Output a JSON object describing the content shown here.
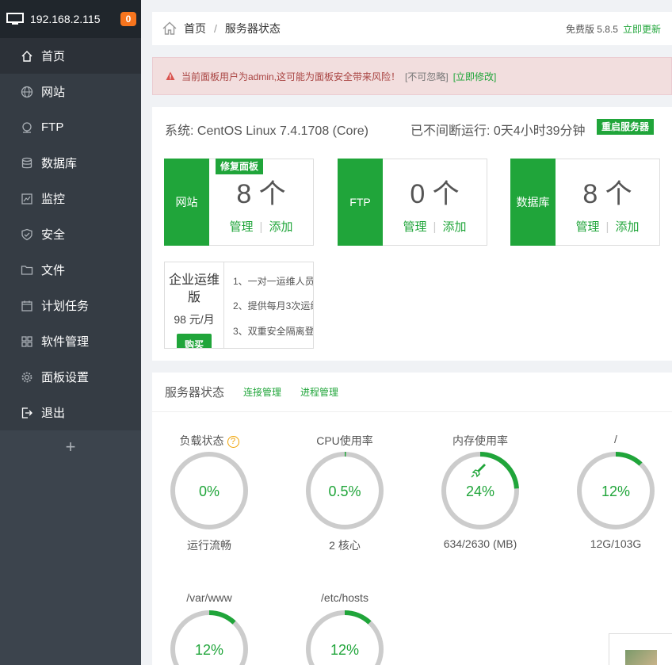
{
  "sidebar": {
    "ip": "192.168.2.115",
    "badge": "0",
    "items": [
      {
        "label": "首页",
        "icon": "home-icon"
      },
      {
        "label": "网站",
        "icon": "globe-icon"
      },
      {
        "label": "FTP",
        "icon": "ftp-icon"
      },
      {
        "label": "数据库",
        "icon": "database-icon"
      },
      {
        "label": "监控",
        "icon": "monitor-icon"
      },
      {
        "label": "安全",
        "icon": "shield-icon"
      },
      {
        "label": "文件",
        "icon": "folder-icon"
      },
      {
        "label": "计划任务",
        "icon": "calendar-icon"
      },
      {
        "label": "软件管理",
        "icon": "grid-icon"
      },
      {
        "label": "面板设置",
        "icon": "gear-icon"
      },
      {
        "label": "退出",
        "icon": "logout-icon"
      }
    ],
    "add": "+"
  },
  "topbar": {
    "crumb_home": "首页",
    "crumb_sep": "/",
    "crumb_current": "服务器状态",
    "version": "免费版 5.8.5",
    "update": "立即更新"
  },
  "alert": {
    "text": "当前面板用户为admin,这可能为面板安全带来风险！",
    "ignore": "[不可忽略]",
    "fix": "[立即修改]"
  },
  "system": {
    "os": "系统: CentOS Linux 7.4.1708 (Core)",
    "uptime": "已不间断运行: 0天4小时39分钟",
    "restart": "重启服务器"
  },
  "cards": [
    {
      "label": "网站",
      "count": "8 个",
      "manage": "管理",
      "sep": "|",
      "add": "添加",
      "tag": "修复面板"
    },
    {
      "label": "FTP",
      "count": "0 个",
      "manage": "管理",
      "sep": "|",
      "add": "添加"
    },
    {
      "label": "数据库",
      "count": "8 个",
      "manage": "管理",
      "sep": "|",
      "add": "添加"
    }
  ],
  "enterprise": {
    "title": "企业运维版",
    "price": "98 元/月",
    "buy": "购买",
    "features": [
      "1、一对一运维人员",
      "2、提供每月3次运维",
      "3、双重安全隔离登"
    ]
  },
  "status": {
    "title": "服务器状态",
    "links": [
      "连接管理",
      "进程管理"
    ],
    "gauges": [
      {
        "title": "负载状态",
        "value": "0%",
        "percent": 0,
        "bottom": "运行流畅",
        "help": "?"
      },
      {
        "title": "CPU使用率",
        "value": "0.5%",
        "percent": 0.5,
        "bottom": "2 核心"
      },
      {
        "title": "内存使用率",
        "value": "24%",
        "percent": 24,
        "bottom": "634/2630 (MB)",
        "rocket": true
      },
      {
        "title": "/",
        "value": "12%",
        "percent": 12,
        "bottom": "12G/103G"
      },
      {
        "title": "/var/www",
        "value": "12%",
        "percent": 12,
        "bottom": ""
      },
      {
        "title": "/etc/hosts",
        "value": "12%",
        "percent": 12,
        "bottom": ""
      }
    ]
  },
  "colors": {
    "accent": "#20a53a",
    "sidebar": "#3c444d",
    "ring": "#cccccc"
  }
}
